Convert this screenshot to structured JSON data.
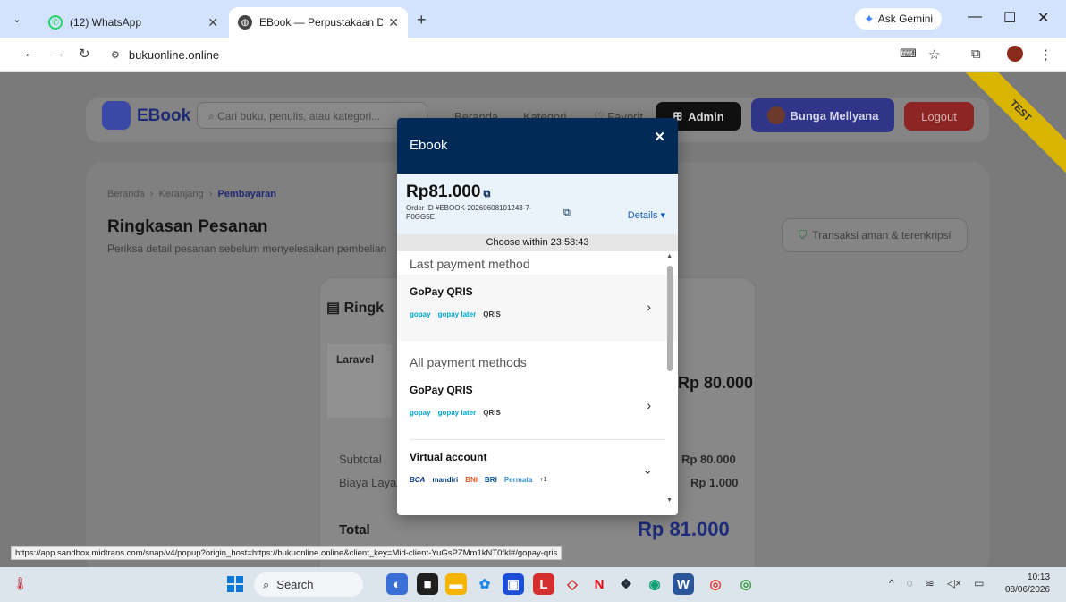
{
  "browser": {
    "tabs": [
      {
        "title": "(12) WhatsApp",
        "active": false
      },
      {
        "title": "EBook — Perpustakaan Digital",
        "active": true
      }
    ],
    "new_tab": "+",
    "gemini": "Ask Gemini",
    "url": "bukuonline.online"
  },
  "site": {
    "brand": "EBook",
    "search_placeholder": "Cari buku, penulis, atau kategori...",
    "nav": [
      "Beranda",
      "Kategori",
      "Favorit"
    ],
    "admin": "Admin",
    "user": "Bunga Mellyana",
    "logout": "Logout",
    "ribbon": "TEST",
    "breadcrumb": [
      "Beranda",
      "Keranjang",
      "Pembayaran"
    ],
    "heading": "Ringkasan Pesanan",
    "subheading": "Periksa detail pesanan sebelum menyelesaikan pembelian",
    "secure_badge": "Transaksi aman & terenkripsi",
    "summary_title": "Ringk",
    "book_title": "Laravel",
    "item_price": "Rp 80.000",
    "subtotal_label": "Subtotal",
    "subtotal_value": "Rp 80.000",
    "fee_label": "Biaya Layan",
    "fee_value": "Rp 1.000",
    "total_label": "Total",
    "total_value": "Rp 81.000"
  },
  "modal": {
    "title": "Ebook",
    "amount": "Rp81.000",
    "order_id": "Order ID #EBOOK-20260608101243-7-P0GG5E",
    "details": "Details",
    "timer": "Choose within 23:58:43",
    "last_section": "Last payment method",
    "all_section": "All payment methods",
    "methods": {
      "last_gopay": {
        "name": "GoPay QRIS",
        "logos": [
          "gopay",
          "gopay later",
          "QRIS"
        ]
      },
      "gopay": {
        "name": "GoPay QRIS",
        "logos": [
          "gopay",
          "gopay later",
          "QRIS"
        ]
      },
      "va": {
        "name": "Virtual account",
        "logos": [
          "BCA",
          "mandiri",
          "BNI",
          "BRI",
          "Permata",
          "+1"
        ]
      }
    }
  },
  "status_url": "https://app.sandbox.midtrans.com/snap/v4/popup?origin_host=https://bukuonline.online&client_key=Mid-client-YuGsPZMm1kNT0fkl#/gopay-qris",
  "taskbar": {
    "search": "Search",
    "time": "10:13",
    "date": "08/06/2026"
  }
}
